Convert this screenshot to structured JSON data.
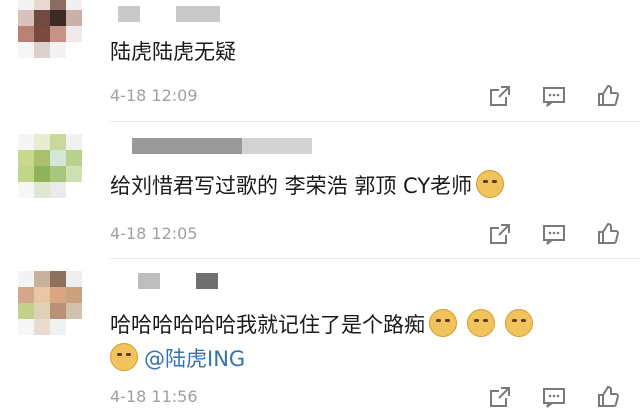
{
  "comments": [
    {
      "text": "陆虎陆虎无疑",
      "time": "4-18 12:09",
      "avatar": [
        "#f2f2f2",
        "#e9d7d2",
        "#8c6b62",
        "#efefef",
        "#d8c2bd",
        "#6e4a3f",
        "#3d2a25",
        "#cbb0aa",
        "#b98174",
        "#7a4a3e",
        "#c79386",
        "#efe9e7",
        "#f6f6f6",
        "#ddd1ce",
        "#f3f3f3",
        "#ffffff"
      ]
    },
    {
      "text": "给刘惜君写过歌的 李荣浩 郭顶 CY老师",
      "time": "4-18 12:05",
      "avatar": [
        "#f5f5f5",
        "#e8edd2",
        "#cad79a",
        "#f1f1f1",
        "#c8d98f",
        "#a8c16a",
        "#d3e6d8",
        "#b8d28b",
        "#c2d68a",
        "#8fb358",
        "#a7c77c",
        "#cfe0b3",
        "#f7f7f7",
        "#dfe7d0",
        "#eaeaea",
        "#ffffff"
      ]
    },
    {
      "text_lines": [
        "哈哈哈哈哈哈我就记住了是个路痴",
        "@陆虎ING"
      ],
      "time": "4-18 11:56",
      "avatar": [
        "#f3f3f3",
        "#c8b19d",
        "#8d6f5b",
        "#eeeeee",
        "#d3a789",
        "#e6c6a4",
        "#d9a681",
        "#cba07d",
        "#c0d18d",
        "#e0d0b8",
        "#b79276",
        "#d1c0ac",
        "#f6f6f6",
        "#e7dccf",
        "#f1f1f1",
        "#ffffff"
      ]
    }
  ],
  "icons": [
    "share-icon",
    "comment-icon",
    "like-icon"
  ]
}
